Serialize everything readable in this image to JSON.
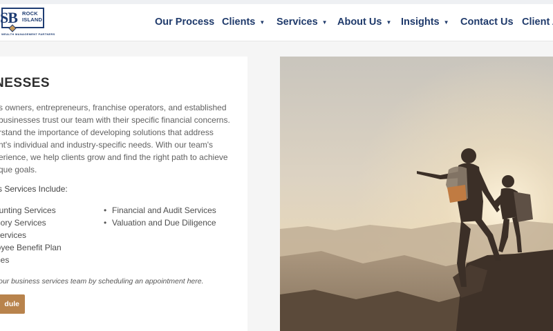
{
  "logo": {
    "mark": "SB",
    "line1": "ROCK",
    "line2": "ISLAND",
    "tagline": "WEALTH MANAGEMENT PARTNERS"
  },
  "nav": {
    "items": [
      {
        "label": "Our Process",
        "dropdown": false
      },
      {
        "label": "Clients",
        "dropdown": true
      },
      {
        "label": "Services",
        "dropdown": true
      },
      {
        "label": "About Us",
        "dropdown": true
      },
      {
        "label": "Insights",
        "dropdown": true
      },
      {
        "label": "Contact Us",
        "dropdown": false
      },
      {
        "label": "Client A",
        "dropdown": false
      }
    ],
    "chevron": "⌄"
  },
  "content": {
    "heading": "NESSES",
    "paragraph_lines": [
      "s owners, entrepreneurs, franchise operators, and established",
      "businesses trust our team with their specific financial concerns.",
      "rstand the importance of developing solutions that address",
      "nt's individual and industry-specific needs. With our team's",
      "erience, we help clients grow and find the right path to achieve",
      "que goals."
    ],
    "services_title": "s Services Include:",
    "services_col1": [
      "ounting Services",
      "isory Services",
      "Services",
      "loyee Benefit Plan",
      "ices"
    ],
    "services_col2": [
      "Financial and Audit Services",
      "Valuation and Due Diligence"
    ],
    "bullet": "•",
    "note": "our business services team by scheduling an appointment here.",
    "button_label": "dule"
  },
  "colors": {
    "nav_text": "#1f3a6b",
    "button": "#b8834c",
    "brand": "#1e3c72"
  }
}
